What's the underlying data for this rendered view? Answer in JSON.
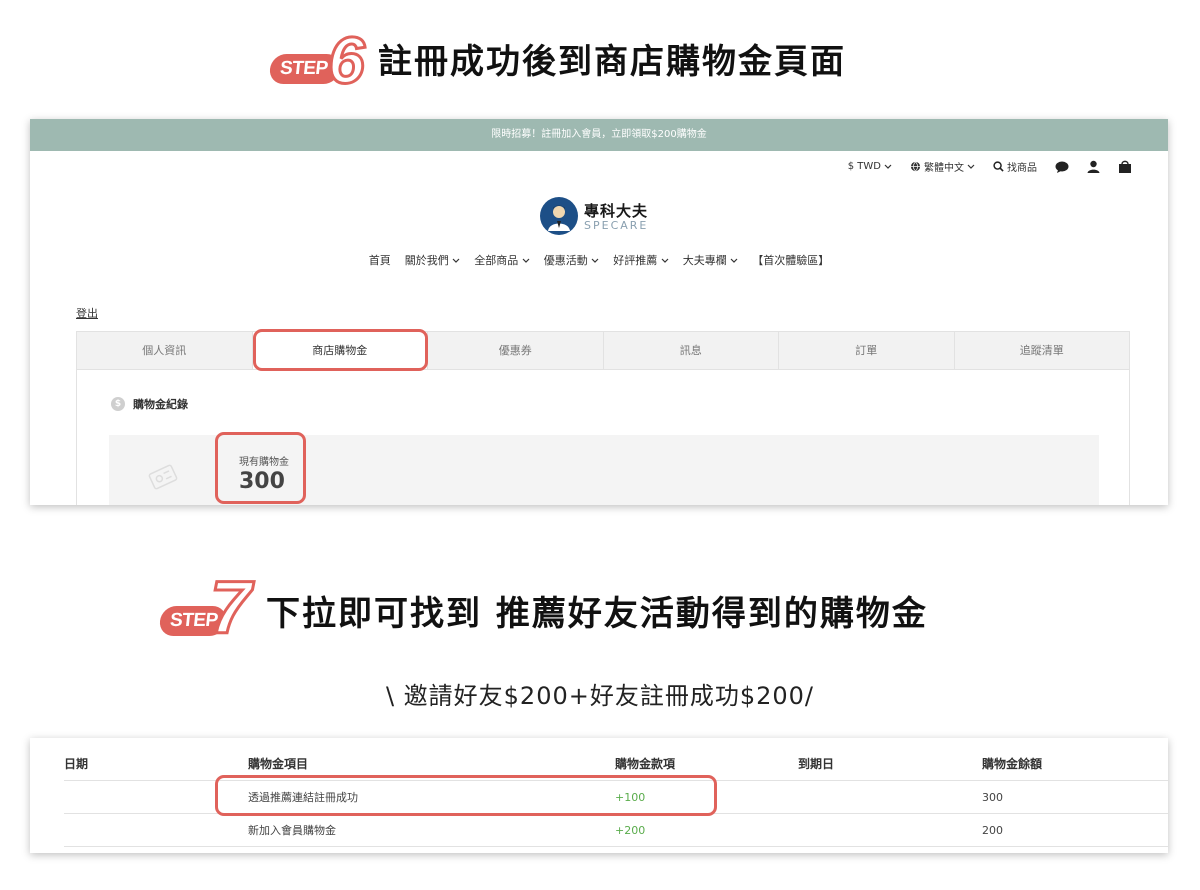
{
  "step6": {
    "pill": "STEP",
    "num": "6",
    "title": "註冊成功後到商店購物金頁面"
  },
  "step7": {
    "pill": "STEP",
    "num": "7",
    "title": "下拉即可找到 推薦好友活動得到的購物金"
  },
  "promo": "限時招募！註冊加入會員，立即領取$200購物金",
  "utility": {
    "currency": "$ TWD",
    "language": "繁體中文",
    "search": "找商品"
  },
  "logo": {
    "cn": "專科大夫",
    "en": "SPECARE"
  },
  "nav": [
    "首頁",
    "關於我們",
    "全部商品",
    "優惠活動",
    "好評推薦",
    "大夫專欄",
    "【首次體驗區】"
  ],
  "logout": "登出",
  "tabs": [
    "個人資訊",
    "商店購物金",
    "優惠券",
    "訊息",
    "訂單",
    "追蹤清單"
  ],
  "credit": {
    "section": "購物金紀錄",
    "label": "現有購物金",
    "value": "300"
  },
  "subtitle": "\\ 邀請好友$200+好友註冊成功$200/",
  "table": {
    "headers": [
      "日期",
      "購物金項目",
      "購物金款項",
      "到期日",
      "購物金餘額"
    ],
    "rows": [
      {
        "date": "",
        "item": "透過推薦連結註冊成功",
        "amount": "+100",
        "expiry": "",
        "balance": "300"
      },
      {
        "date": "",
        "item": "新加入會員購物金",
        "amount": "+200",
        "expiry": "",
        "balance": "200"
      }
    ]
  },
  "colors": {
    "accent": "#e0625b",
    "promo_bar": "#9eb9b1",
    "positive": "#5aac4c"
  },
  "icons": [
    "chevron-down-icon",
    "globe-icon",
    "search-icon",
    "chat-icon",
    "user-icon",
    "cart-icon",
    "coin-icon",
    "coupon-icon"
  ]
}
